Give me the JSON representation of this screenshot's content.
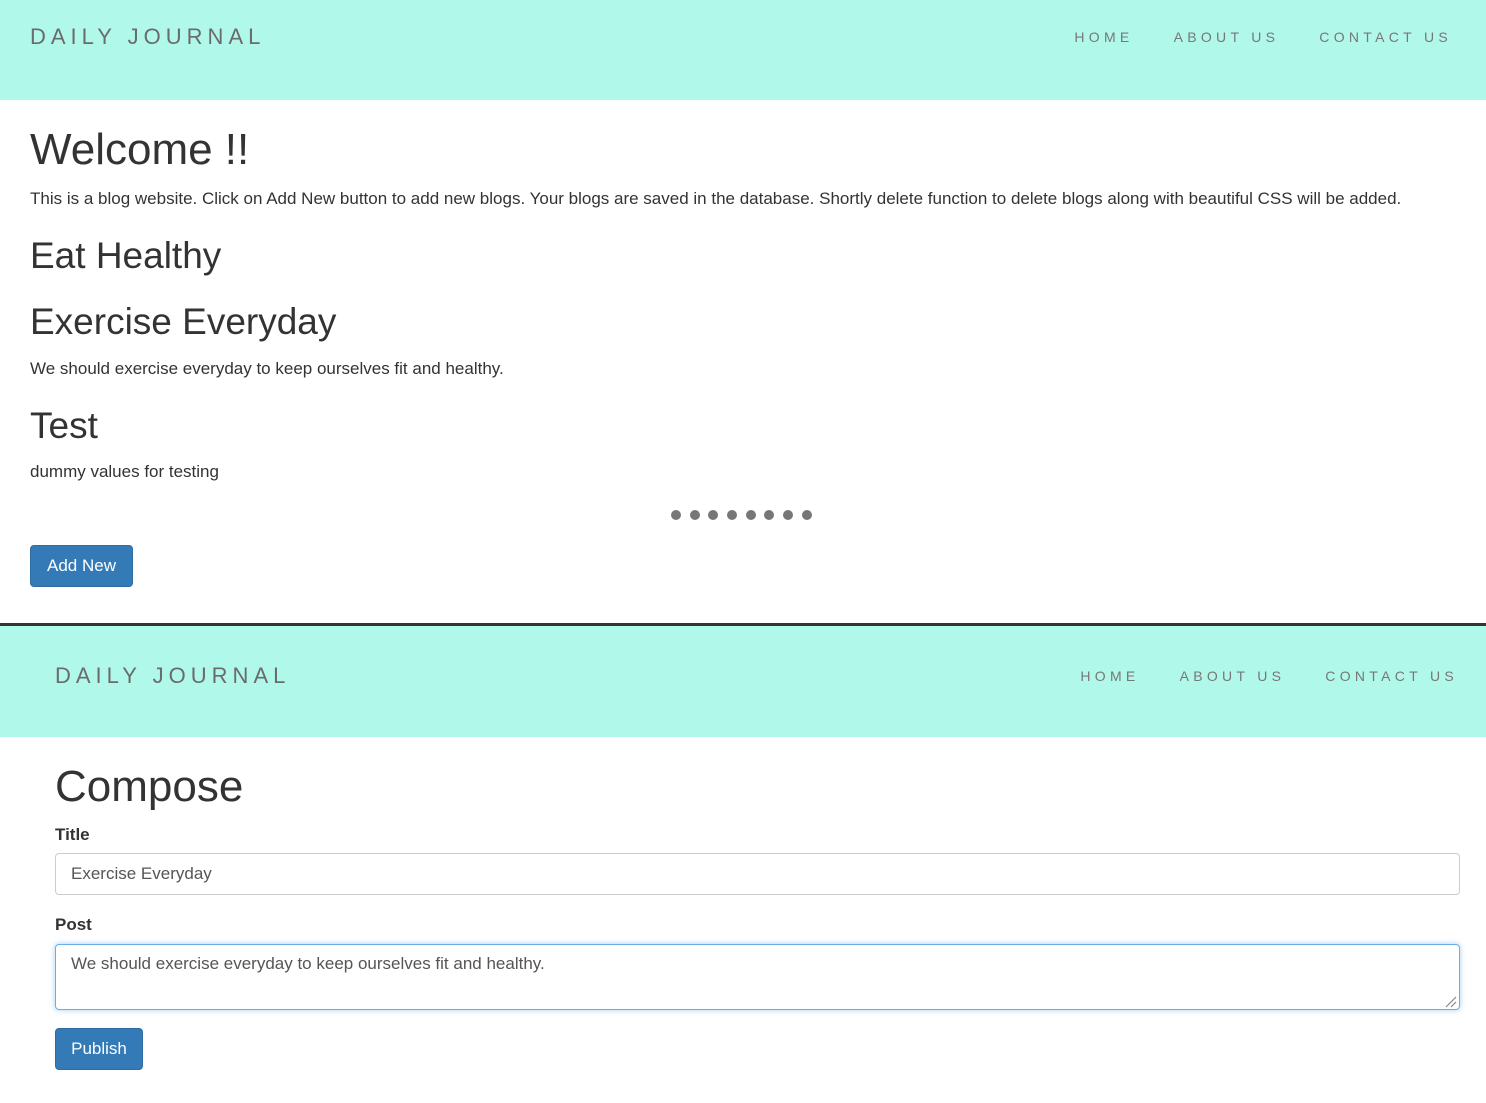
{
  "top": {
    "nav": {
      "brand": "DAILY JOURNAL",
      "links": [
        "HOME",
        "ABOUT US",
        "CONTACT US"
      ]
    },
    "heading": "Welcome !!",
    "intro": "This is a blog website. Click on Add New button to add new blogs. Your blogs are saved in the database. Shortly delete function to delete blogs along with beautiful CSS will be added.",
    "posts": [
      {
        "title": "Eat Healthy",
        "body": ""
      },
      {
        "title": "Exercise Everyday",
        "body": "We should exercise everyday to keep ourselves fit and healthy."
      },
      {
        "title": "Test",
        "body": "dummy values for testing"
      }
    ],
    "add_button": "Add New"
  },
  "bottom": {
    "nav": {
      "brand": "DAILY JOURNAL",
      "links": [
        "HOME",
        "ABOUT US",
        "CONTACT US"
      ]
    },
    "heading": "Compose",
    "title_label": "Title",
    "title_value": "Exercise Everyday",
    "post_label": "Post",
    "post_value": "We should exercise everyday to keep ourselves fit and healthy.",
    "publish_button": "Publish"
  },
  "colors": {
    "navbar_bg": "#b0f9ea",
    "button_bg": "#337ab7",
    "focus_border": "#66afe9"
  },
  "icons": [
    "resize-grip-icon",
    "dots-separator"
  ]
}
